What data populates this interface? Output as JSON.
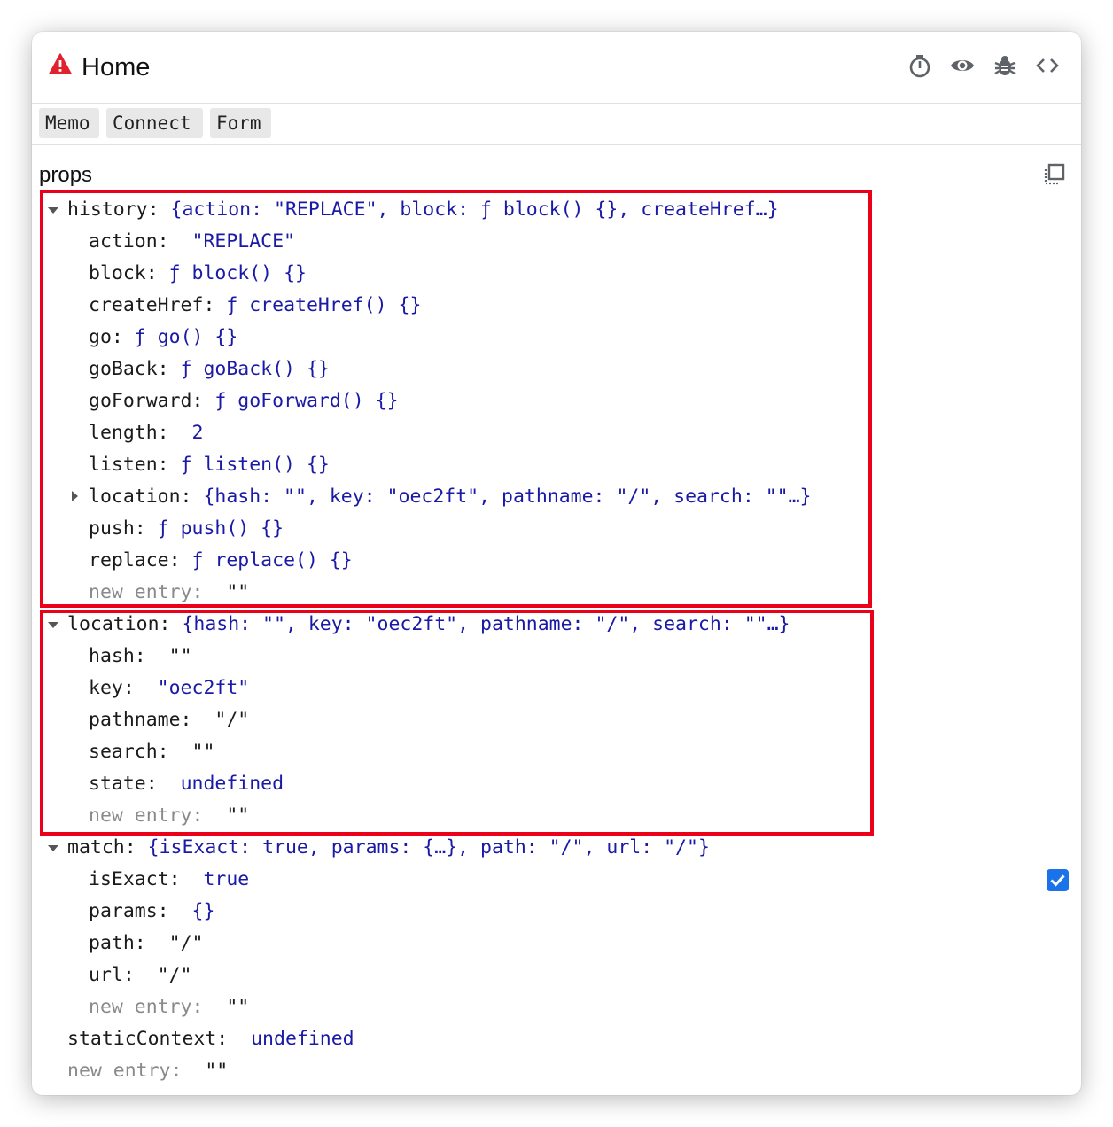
{
  "header": {
    "title": "Home",
    "icons": [
      "warning-icon",
      "stopwatch-icon",
      "eye-icon",
      "bug-icon",
      "code-icon"
    ],
    "warning_color": "#e0222f"
  },
  "hocs": [
    "Memo",
    "Connect",
    "Form"
  ],
  "props_label": "props",
  "tree": {
    "history": {
      "key": "history:",
      "summary": "{action: \"REPLACE\", block: ƒ block() {}, createHref…}",
      "children": [
        {
          "key": "action:",
          "value": "\"REPLACE\""
        },
        {
          "key": "block:",
          "value": "ƒ block() {}"
        },
        {
          "key": "createHref:",
          "value": "ƒ createHref() {}"
        },
        {
          "key": "go:",
          "value": "ƒ go() {}"
        },
        {
          "key": "goBack:",
          "value": "ƒ goBack() {}"
        },
        {
          "key": "goForward:",
          "value": "ƒ goForward() {}"
        },
        {
          "key": "length:",
          "value": "2"
        },
        {
          "key": "listen:",
          "value": "ƒ listen() {}"
        },
        {
          "key": "location:",
          "value": "{hash: \"\", key: \"oec2ft\", pathname: \"/\", search: \"\"…}"
        },
        {
          "key": "push:",
          "value": "ƒ push() {}"
        },
        {
          "key": "replace:",
          "value": "ƒ replace() {}"
        },
        {
          "key": "new entry:",
          "value": "\"\""
        }
      ]
    },
    "location": {
      "key": "location:",
      "summary": "{hash: \"\", key: \"oec2ft\", pathname: \"/\", search: \"\"…}",
      "children": [
        {
          "key": "hash:",
          "value": "\"\""
        },
        {
          "key": "key:",
          "value": "\"oec2ft\""
        },
        {
          "key": "pathname:",
          "value": "\"/\""
        },
        {
          "key": "search:",
          "value": "\"\""
        },
        {
          "key": "state:",
          "value": "undefined"
        },
        {
          "key": "new entry:",
          "value": "\"\""
        }
      ]
    },
    "match": {
      "key": "match:",
      "summary": "{isExact: true, params: {…}, path: \"/\", url: \"/\"}",
      "children": [
        {
          "key": "isExact:",
          "value": "true"
        },
        {
          "key": "params:",
          "value": "{}"
        },
        {
          "key": "path:",
          "value": "\"/\""
        },
        {
          "key": "url:",
          "value": "\"/\""
        },
        {
          "key": "new entry:",
          "value": "\"\""
        }
      ]
    },
    "staticContext": {
      "key": "staticContext:",
      "value": "undefined"
    },
    "new_entry": {
      "key": "new entry:",
      "value": "\"\""
    }
  },
  "colors": {
    "highlight": "#ea0019",
    "value": "#1a1aa6",
    "checkbox": "#1a73e8"
  }
}
